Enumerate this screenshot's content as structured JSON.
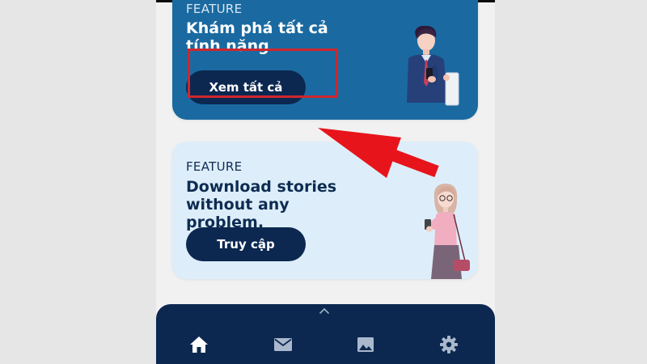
{
  "cards": [
    {
      "label": "FEATURE",
      "title": "Khám phá tất cả tính năng",
      "button_label": "Xem tất cả",
      "illustration": "man-with-phone-illustration"
    },
    {
      "label": "FEATURE",
      "title": "Download stories without any problem.",
      "button_label": "Truy cập",
      "illustration": "woman-with-phone-illustration"
    }
  ],
  "bottom_nav": {
    "items": [
      {
        "icon": "home-icon",
        "active": true
      },
      {
        "icon": "mail-icon",
        "active": false
      },
      {
        "icon": "image-icon",
        "active": false
      },
      {
        "icon": "gear-icon",
        "active": false
      }
    ],
    "handle_icon": "chevron-up-icon"
  },
  "annotations": {
    "highlight_color": "#d0262d",
    "arrow_color": "#e8141c"
  },
  "colors": {
    "card1_bg": "#1a6aa1",
    "card2_bg": "#ddeefa",
    "button_bg": "#0c2850",
    "nav_bg": "#0c2850"
  }
}
